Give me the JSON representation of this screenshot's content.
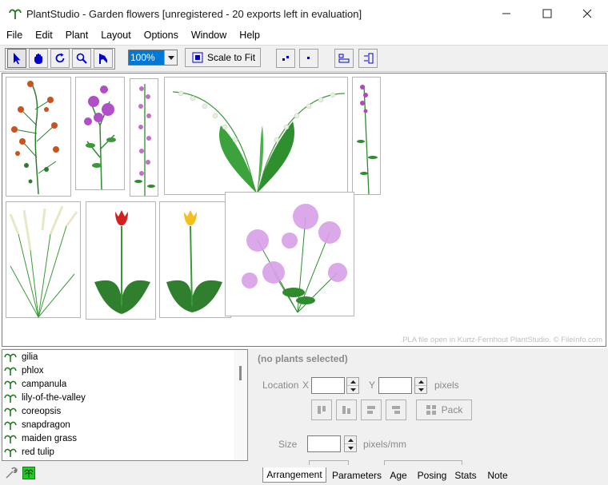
{
  "window": {
    "title": "PlantStudio - Garden flowers [unregistered - 20 exports left in evaluation]",
    "controls": [
      "minimize-icon",
      "maximize-icon",
      "close-icon"
    ]
  },
  "menu": [
    "File",
    "Edit",
    "Plant",
    "Layout",
    "Options",
    "Window",
    "Help"
  ],
  "toolbar": {
    "tools": [
      "pointer-icon",
      "hand-icon",
      "rotate-icon",
      "magnifier-icon",
      "flag-icon"
    ],
    "zoom_value": "100%",
    "scale_to_fit_label": "Scale to Fit",
    "view_buttons": [
      "small-dots-icon",
      "single-dot-icon",
      "align-left-icon",
      "align-right-icon"
    ]
  },
  "canvas": {
    "plants": [
      "gilia",
      "phlox",
      "campanula",
      "lily-of-the-valley",
      "coreopsis",
      "snapdragon",
      "maiden grass",
      "red tulip",
      "yellow tulip",
      "purple flowers"
    ],
    "watermark": ".PLA file open in Kurtz-Fernhout PlantStudio. © FileInfo.com"
  },
  "plant_list": {
    "items": [
      "gilia",
      "phlox",
      "campanula",
      "lily-of-the-valley",
      "coreopsis",
      "snapdragon",
      "maiden grass",
      "red tulip"
    ]
  },
  "panel": {
    "header": "(no plants selected)",
    "location_label": "Location",
    "x_label": "X",
    "y_label": "Y",
    "pixels_label": "pixels",
    "pack_label": "Pack",
    "size_label": "Size",
    "size_unit": "pixels/mm"
  },
  "tabs": [
    "Arrangement",
    "Parameters",
    "Age",
    "Posing",
    "Stats",
    "Note"
  ],
  "colors": {
    "accent": "#0078d7",
    "green": "#2e8b2e",
    "tulip_red": "#d42020",
    "tulip_yellow": "#f0c020",
    "lilac": "#c080e0"
  }
}
